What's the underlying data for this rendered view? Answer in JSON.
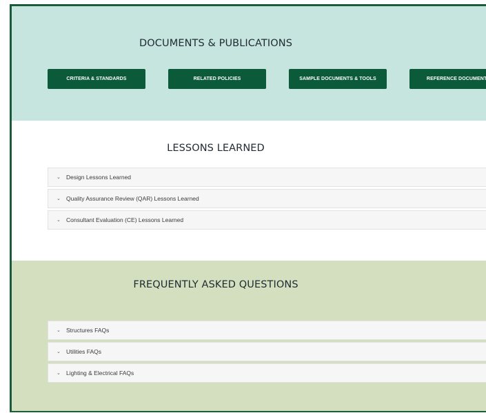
{
  "documents": {
    "title": "DOCUMENTS & PUBLICATIONS",
    "buttons": [
      "CRITERIA & STANDARDS",
      "RELATED POLICIES",
      "SAMPLE DOCUMENTS & TOOLS",
      "REFERENCE DOCUMENTS"
    ]
  },
  "lessons": {
    "title": "LESSONS LEARNED",
    "items": [
      "Design Lessons Learned",
      "Quality Assurance Review (QAR) Lessons Learned",
      "Consultant Evaluation (CE) Lessons Learned"
    ]
  },
  "faq": {
    "title": "FREQUENTLY ASKED QUESTIONS",
    "items": [
      "Structures FAQs",
      "Utilities FAQs",
      "Lighting & Electrical FAQs"
    ]
  },
  "icons": {
    "accordion": "chevron-down-icon"
  },
  "colors": {
    "docs_bg": "#c7e5df",
    "faq_bg": "#d3dfbe",
    "button_bg": "#0b5a3a",
    "frame": "#1b5b3a"
  }
}
